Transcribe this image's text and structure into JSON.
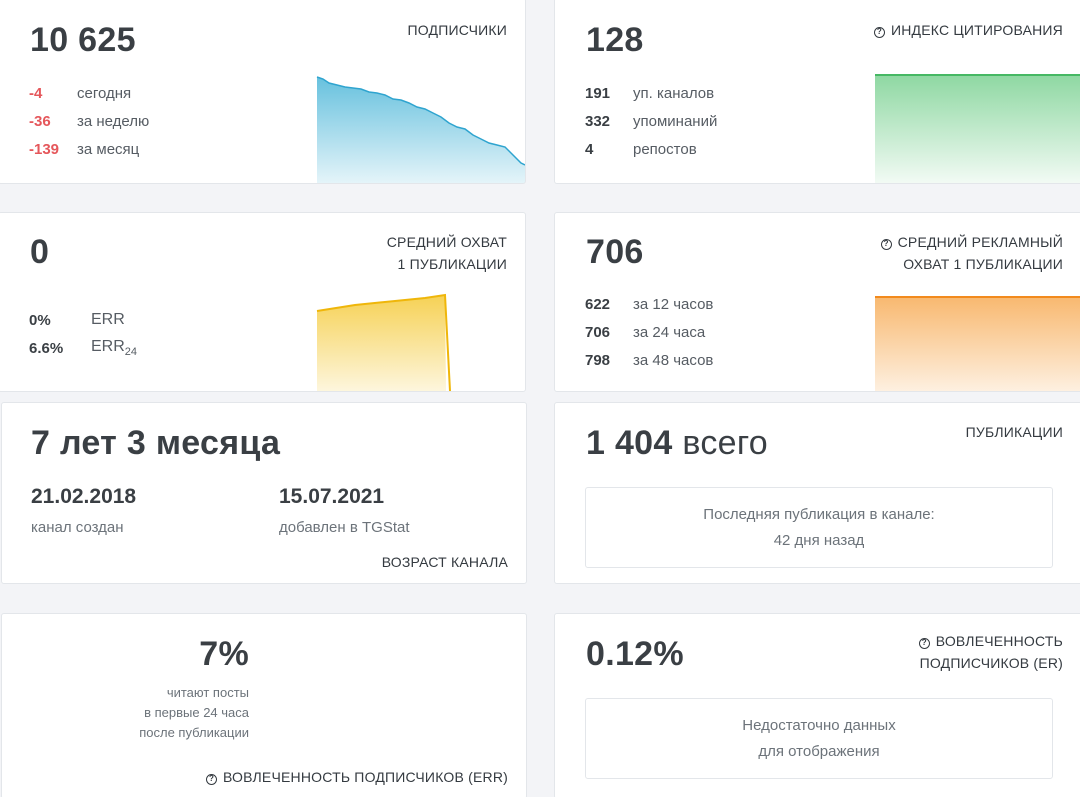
{
  "subscribers": {
    "title": "ПОДПИСЧИКИ",
    "value": "10 625",
    "rows": [
      {
        "value": "-4",
        "label": "сегодня"
      },
      {
        "value": "-36",
        "label": "за неделю"
      },
      {
        "value": "-139",
        "label": "за месяц"
      }
    ],
    "chart_color": "#4cb6d8"
  },
  "citation": {
    "title": "ИНДЕКС ЦИТИРОВАНИЯ",
    "value": "128",
    "rows": [
      {
        "value": "191",
        "label": "уп. каналов"
      },
      {
        "value": "332",
        "label": "упоминаний"
      },
      {
        "value": "4",
        "label": "репостов"
      }
    ],
    "chart_color": "#5ec77a"
  },
  "reach": {
    "title_line1": "СРЕДНИЙ ОХВАТ",
    "title_line2": "1 ПУБЛИКАЦИИ",
    "value": "0",
    "rows": [
      {
        "value": "0%",
        "label": "ERR"
      },
      {
        "value": "6.6%",
        "label": "ERR",
        "sub": "24"
      }
    ],
    "chart_color": "#f3c21c"
  },
  "ad_reach": {
    "title_line1": "СРЕДНИЙ РЕКЛАМНЫЙ",
    "title_line2": "ОХВАТ 1 ПУБЛИКАЦИИ",
    "value": "706",
    "rows": [
      {
        "value": "622",
        "label": "за 12 часов"
      },
      {
        "value": "706",
        "label": "за 24 часа"
      },
      {
        "value": "798",
        "label": "за 48 часов"
      }
    ],
    "chart_color": "#f59a32"
  },
  "age": {
    "title": "ВОЗРАСТ КАНАЛА",
    "value": "7 лет 3 месяца",
    "created_date": "21.02.2018",
    "created_label": "канал создан",
    "added_date": "15.07.2021",
    "added_label": "добавлен в TGStat"
  },
  "publications": {
    "title": "ПУБЛИКАЦИИ",
    "value": "1 404",
    "value_suffix": "всего",
    "box_line1": "Последняя публикация в канале:",
    "box_line2": "42 дня назад"
  },
  "err24": {
    "value": "7%",
    "note_line1": "читают посты",
    "note_line2": "в первые 24 часа",
    "note_line3": "после публикации",
    "footer": "ВОВЛЕЧЕННОСТЬ ПОДПИСЧИКОВ (ERR)"
  },
  "er": {
    "title_line1": "ВОВЛЕЧЕННОСТЬ",
    "title_line2": "ПОДПИСЧИКОВ (ER)",
    "value": "0.12%",
    "box_line1": "Недостаточно данных",
    "box_line2": "для отображения"
  },
  "icons": {
    "help": "question-circle-icon"
  }
}
